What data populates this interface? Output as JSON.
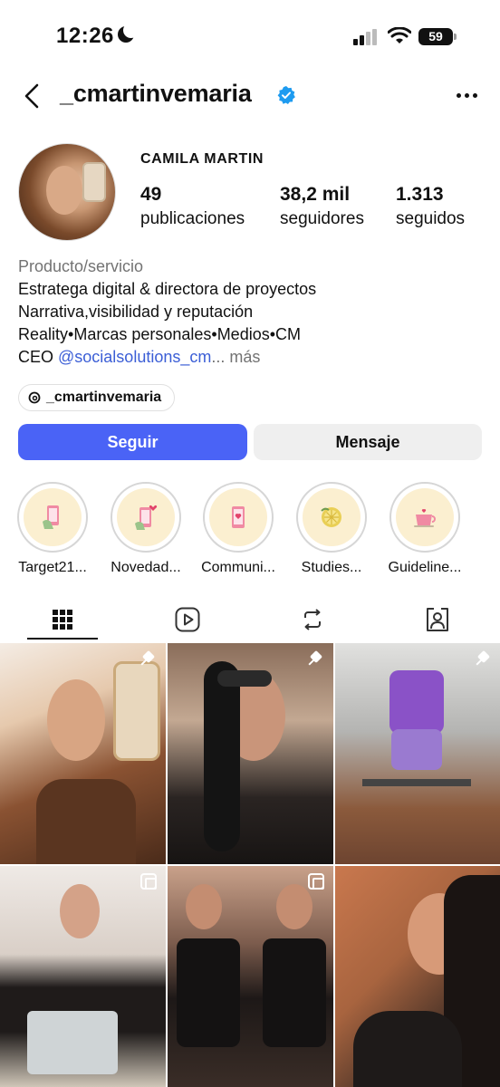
{
  "status_bar": {
    "time": "12:26",
    "battery": "59"
  },
  "header": {
    "username": "_cmartinvemaria",
    "verified": true
  },
  "profile": {
    "full_name": "CAMILA MARTIN",
    "stats": [
      {
        "value": "49",
        "label": "publicaciones"
      },
      {
        "value": "38,2 mil",
        "label": "seguidores"
      },
      {
        "value": "1.313",
        "label": "seguidos"
      }
    ],
    "category": "Producto/servicio",
    "bio_lines": [
      "Estratega digital & directora de proyectos",
      "Narrativa,visibilidad y reputación",
      "Reality•Marcas personales•Medios•CM"
    ],
    "bio_last_prefix": "CEO ",
    "bio_mention": "@socialsolutions_cm",
    "bio_more": "... más",
    "threads_handle": "_cmartinvemaria"
  },
  "actions": {
    "follow": "Seguir",
    "message": "Mensaje"
  },
  "highlights": [
    {
      "label": "Target21...",
      "icon": "phone-hand-icon"
    },
    {
      "label": "Novedad...",
      "icon": "phone-hearts-icon"
    },
    {
      "label": "Communi...",
      "icon": "phone-heart-icon"
    },
    {
      "label": "Studies...",
      "icon": "lemon-icon"
    },
    {
      "label": "Guideline...",
      "icon": "coffee-cup-icon"
    }
  ],
  "tabs": [
    {
      "name": "grid",
      "icon": "grid-icon",
      "active": true
    },
    {
      "name": "reels",
      "icon": "reels-icon"
    },
    {
      "name": "reposts",
      "icon": "repost-icon"
    },
    {
      "name": "tagged",
      "icon": "tagged-icon"
    }
  ],
  "posts": [
    {
      "badge": "pin-icon"
    },
    {
      "badge": "pin-icon"
    },
    {
      "badge": "pin-icon"
    },
    {
      "badge": "multi-icon"
    },
    {
      "badge": "multi-icon"
    },
    {
      "badge": ""
    }
  ],
  "colors": {
    "accent": "#4a63f6",
    "link": "#3b5ed6",
    "verified": "#1d9bf0",
    "muted": "#737373"
  }
}
